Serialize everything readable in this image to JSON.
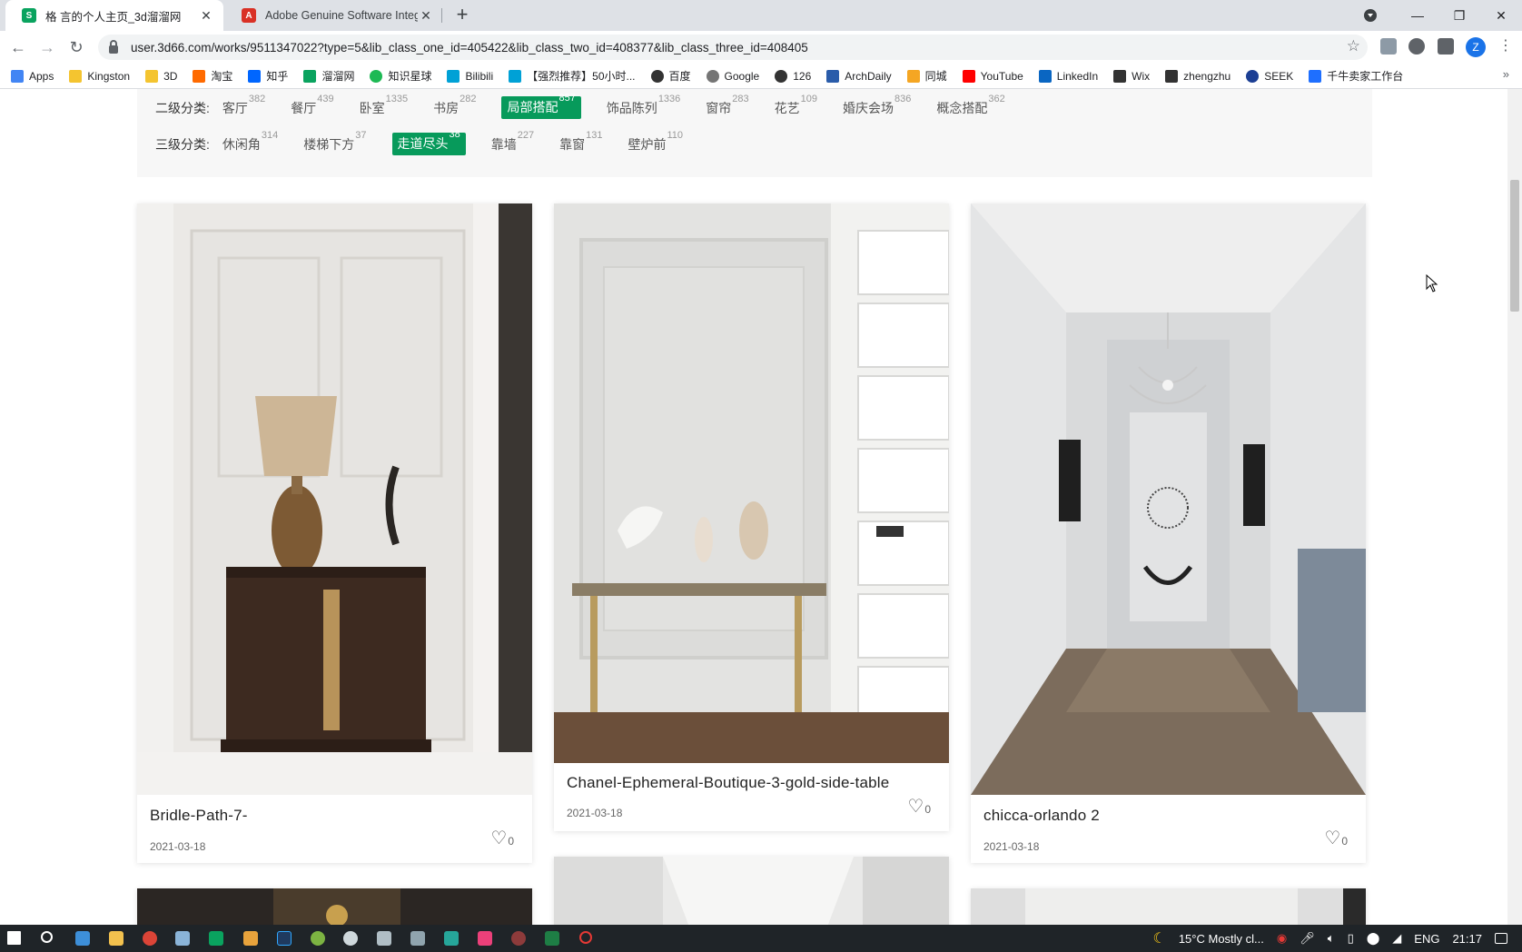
{
  "browser": {
    "tabs": [
      {
        "title": "格 言的个人主页_3d溜溜网",
        "active": true,
        "favicon_color": "#0aa35f"
      },
      {
        "title": "Adobe Genuine Software Integrit",
        "active": false,
        "favicon_color": "#d93025"
      }
    ],
    "new_tab": "+",
    "url": "user.3d66.com/works/9511347022?type=5&lib_class_one_id=405422&lib_class_two_id=408377&lib_class_three_id=408405",
    "profile_letter": "Z",
    "bookmarks": [
      {
        "label": "Apps",
        "color": "#4285f4"
      },
      {
        "label": "Kingston",
        "color": "#f4c430"
      },
      {
        "label": "3D",
        "color": "#f4c430"
      },
      {
        "label": "淘宝",
        "color": "#ff6a00"
      },
      {
        "label": "知乎",
        "color": "#0066ff"
      },
      {
        "label": "溜溜网",
        "color": "#0aa35f"
      },
      {
        "label": "知识星球",
        "color": "#1db954"
      },
      {
        "label": "Bilibili",
        "color": "#00a1d6"
      },
      {
        "label": "【强烈推荐】50小时...",
        "color": "#00a1d6"
      },
      {
        "label": "百度",
        "color": "#333333"
      },
      {
        "label": "Google",
        "color": "#757575"
      },
      {
        "label": "126",
        "color": "#333333"
      },
      {
        "label": "ArchDaily",
        "color": "#2a5caa"
      },
      {
        "label": "同城",
        "color": "#f5a623"
      },
      {
        "label": "YouTube",
        "color": "#ff0000"
      },
      {
        "label": "LinkedIn",
        "color": "#0a66c2"
      },
      {
        "label": "Wix",
        "color": "#333333"
      },
      {
        "label": "zhengzhu",
        "color": "#333333"
      },
      {
        "label": "SEEK",
        "color": "#1c3f94"
      },
      {
        "label": "千牛卖家工作台",
        "color": "#1e6fff"
      }
    ],
    "bookmarks_more": "»"
  },
  "filters": {
    "level2": {
      "label": "二级分类:",
      "items": [
        {
          "name": "客厅",
          "count": "382"
        },
        {
          "name": "餐厅",
          "count": "439"
        },
        {
          "name": "卧室",
          "count": "1335"
        },
        {
          "name": "书房",
          "count": "282"
        },
        {
          "name": "局部搭配",
          "count": "857",
          "active": true
        },
        {
          "name": "饰品陈列",
          "count": "1336"
        },
        {
          "name": "窗帘",
          "count": "283"
        },
        {
          "name": "花艺",
          "count": "109"
        },
        {
          "name": "婚庆会场",
          "count": "836"
        },
        {
          "name": "概念搭配",
          "count": "362"
        }
      ]
    },
    "level3": {
      "label": "三级分类:",
      "items": [
        {
          "name": "休闲角",
          "count": "314"
        },
        {
          "name": "楼梯下方",
          "count": "37"
        },
        {
          "name": "走道尽头",
          "count": "38",
          "active": true
        },
        {
          "name": "靠墙",
          "count": "227"
        },
        {
          "name": "靠窗",
          "count": "131"
        },
        {
          "name": "壁炉前",
          "count": "110"
        }
      ]
    },
    "active_color": "#079a5b"
  },
  "works": [
    {
      "title": "Bridle-Path-7-",
      "date": "2021-03-18",
      "likes": "0"
    },
    {
      "title": "Chanel-Ephemeral-Boutique-3-gold-side-table",
      "date": "2021-03-18",
      "likes": "0"
    },
    {
      "title": "chicca-orlando 2",
      "date": "2021-03-18",
      "likes": "0"
    }
  ],
  "taskbar": {
    "weather": "15°C  Mostly cl...",
    "lang": "ENG",
    "time": "21:17"
  }
}
